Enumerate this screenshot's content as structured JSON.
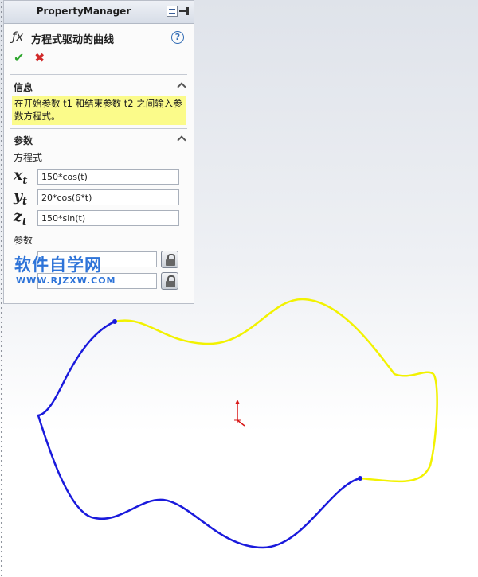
{
  "panel": {
    "title": "PropertyManager",
    "feature_icon": "ƒx",
    "feature_name": "方程式驱动的曲线",
    "help": "?",
    "ok": "✔",
    "cancel": "✖"
  },
  "info_section": {
    "title": "信息",
    "message": "在开始参数 t1 和结束参数 t2 之间输入参数方程式。"
  },
  "params_section": {
    "title": "参数",
    "equations_label": "方程式",
    "equations": [
      {
        "var": "x",
        "sub": "t",
        "value": "150*cos(t)"
      },
      {
        "var": "y",
        "sub": "t",
        "value": "20*cos(6*t)"
      },
      {
        "var": "z",
        "sub": "t",
        "value": "150*sin(t)"
      }
    ],
    "params_label": "参数"
  },
  "watermark": {
    "text": "软件自学网",
    "url": "WWW.RJZXW.COM"
  },
  "colors": {
    "blue_curve": "#1a1adc",
    "yellow_curve": "#f2f200",
    "info_bg": "#fbfb8a",
    "origin_red": "#d81818"
  }
}
